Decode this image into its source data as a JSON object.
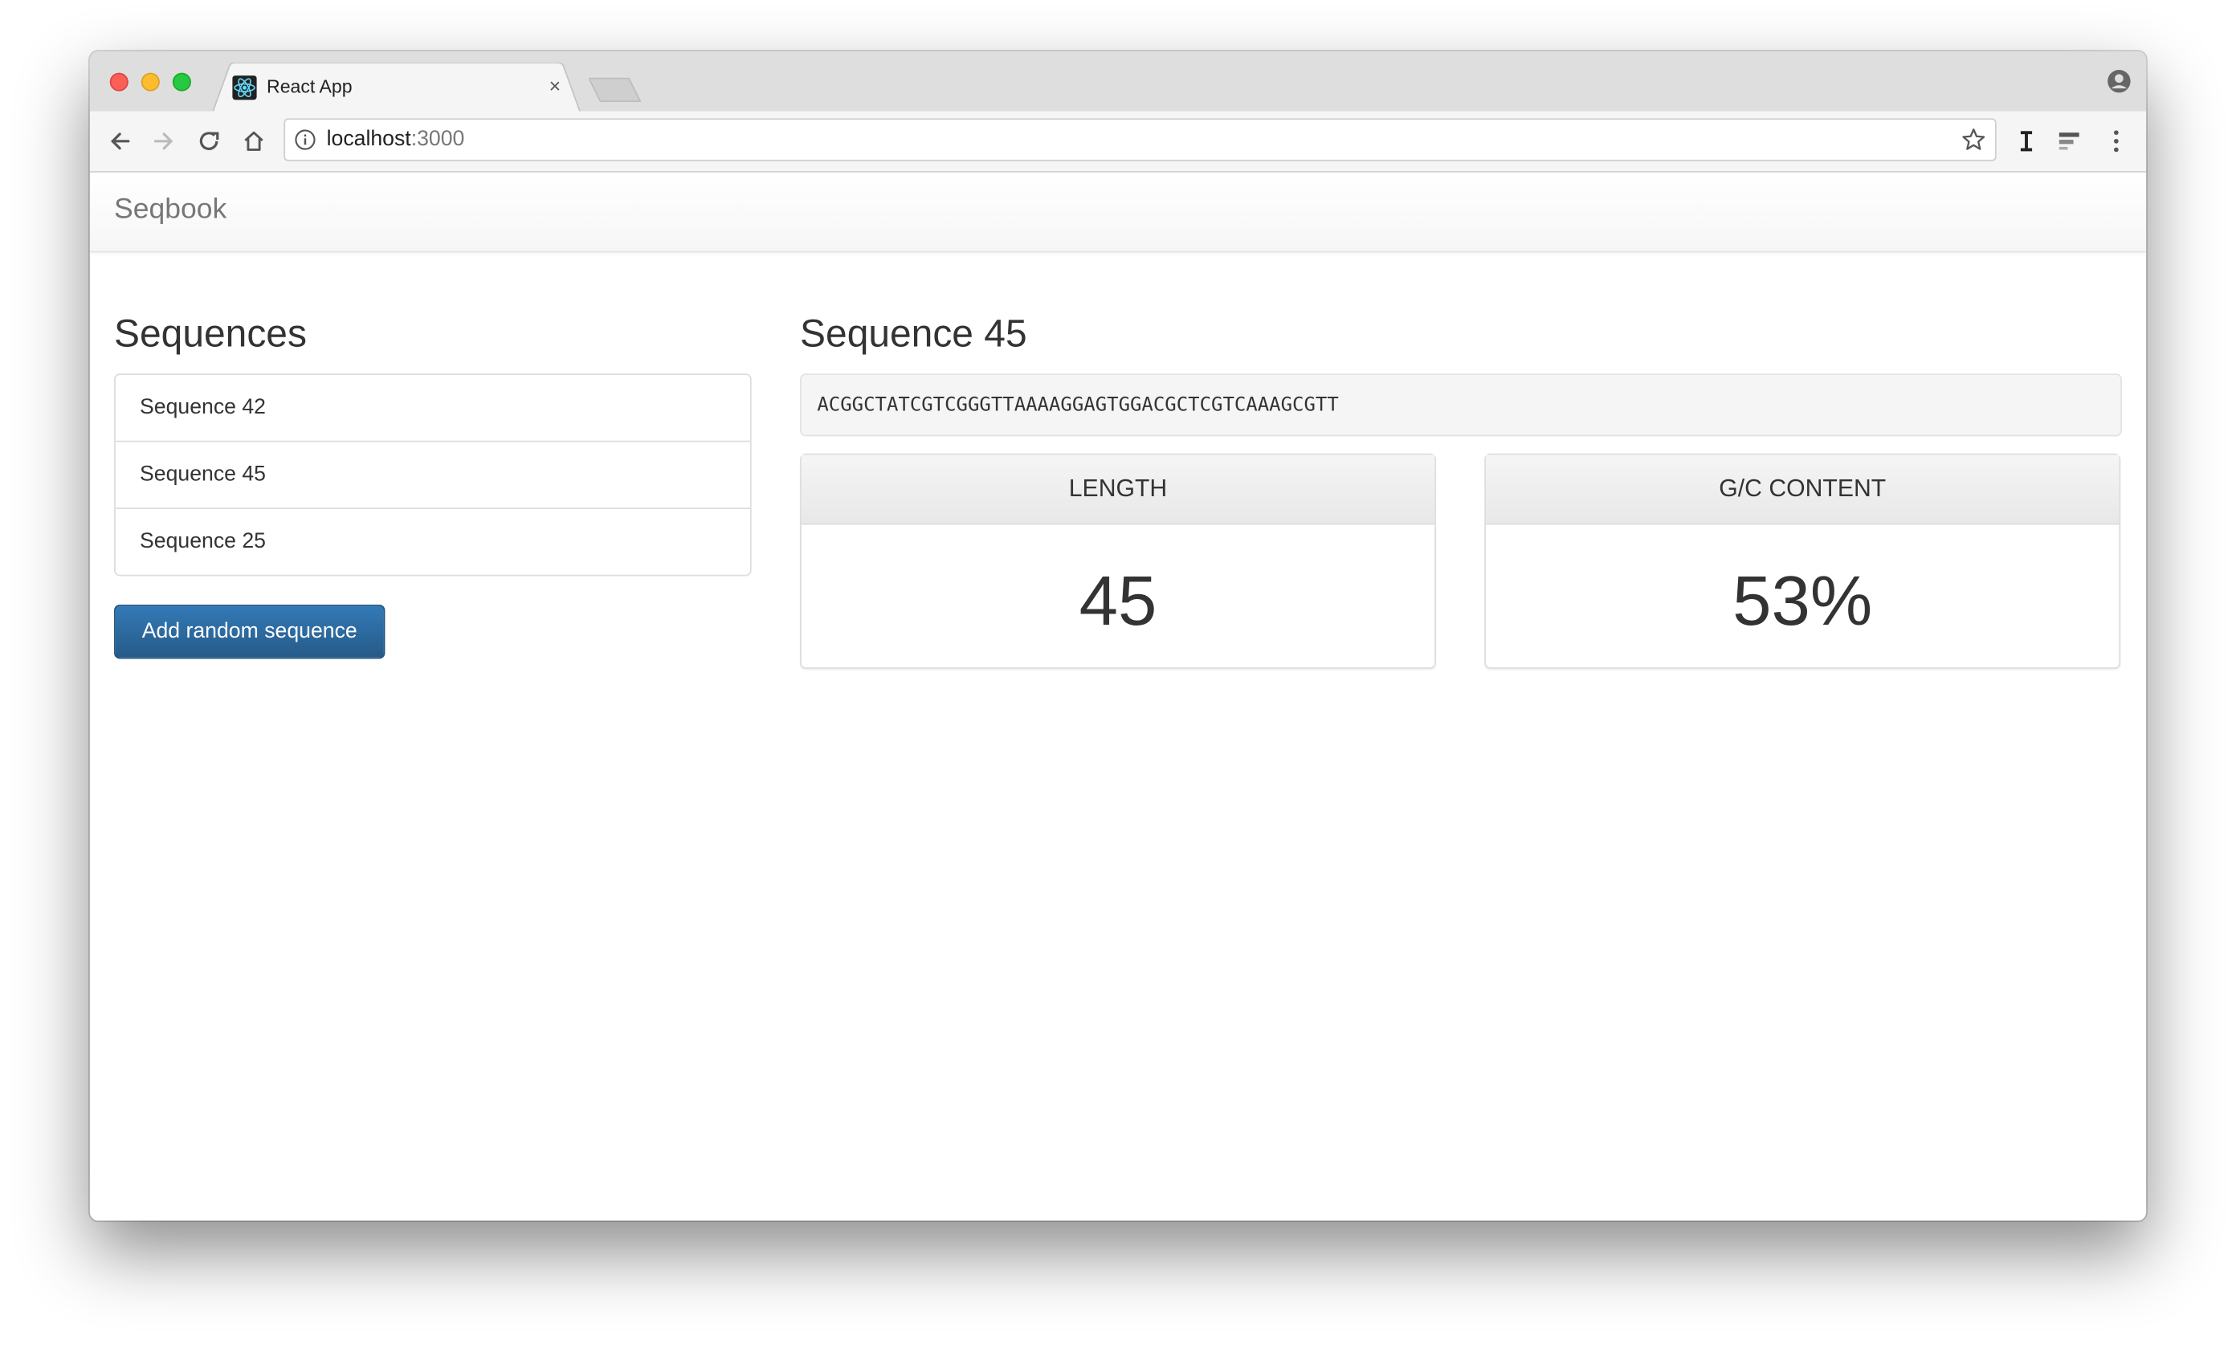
{
  "browser": {
    "tab_title": "React App",
    "close_glyph": "×",
    "url_host": "localhost",
    "url_port": ":3000"
  },
  "app": {
    "brand": "Seqbook",
    "list_heading": "Sequences",
    "sequences": [
      "Sequence 42",
      "Sequence 45",
      "Sequence 25"
    ],
    "add_button": "Add random sequence",
    "detail": {
      "title": "Sequence 45",
      "dna": "ACGGCTATCGTCGGGTTAAAAGGAGTGGACGCTCGTCAAAGCGTT",
      "length_label": "LENGTH",
      "length_value": "45",
      "gc_label": "G/C CONTENT",
      "gc_value": "53%"
    }
  },
  "colors": {
    "primary_button": "#337ab7",
    "traffic_red": "#fc5f57",
    "traffic_yellow": "#fdbc2e",
    "traffic_green": "#28c840"
  }
}
